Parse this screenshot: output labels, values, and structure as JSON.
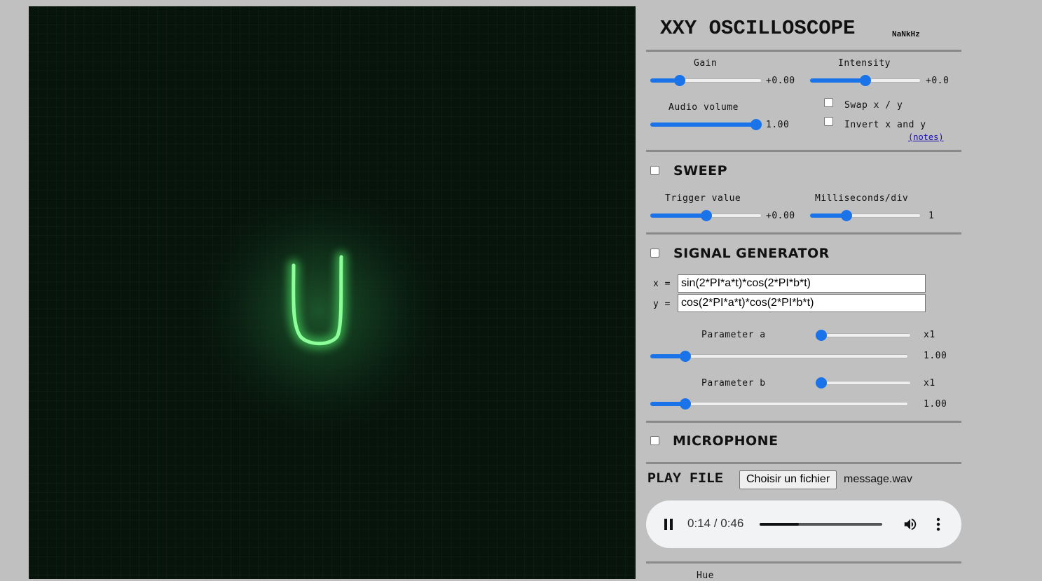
{
  "header": {
    "title": "XXY OSCILLOSCOPE",
    "frequency": "NaNkHz"
  },
  "controls": {
    "gain": {
      "label": "Gain",
      "value": "+0.00",
      "level": 0.24
    },
    "intensity": {
      "label": "Intensity",
      "value": "+0.0",
      "level": 0.5
    },
    "audio_volume": {
      "label": "Audio volume",
      "value": "1.00",
      "level": 1.0
    },
    "swap_xy": {
      "label": "Swap x / y",
      "checked": false
    },
    "invert_xy": {
      "label": "Invert x and y",
      "checked": false
    },
    "notes_link": "(notes)"
  },
  "sweep": {
    "title": "SWEEP",
    "checked": false,
    "trigger": {
      "label": "Trigger value",
      "value": "+0.00",
      "level": 0.5
    },
    "ms_per_div": {
      "label": "Milliseconds/div",
      "value": "1",
      "level": 0.31
    }
  },
  "signal_generator": {
    "title": "SIGNAL GENERATOR",
    "checked": false,
    "x_label": "x =",
    "y_label": "y =",
    "x_expr": "sin(2*PI*a*t)*cos(2*PI*b*t)",
    "y_expr": "cos(2*PI*a*t)*cos(2*PI*b*t)",
    "param_a": {
      "label": "Parameter a",
      "multiplier": "x1",
      "value": "1.00",
      "coarse_level": 0.0,
      "fine_level": 0.12
    },
    "param_b": {
      "label": "Parameter b",
      "multiplier": "x1",
      "value": "1.00",
      "coarse_level": 0.0,
      "fine_level": 0.12
    }
  },
  "microphone": {
    "title": "MICROPHONE",
    "checked": false
  },
  "play_file": {
    "title": "PLAY FILE",
    "button_label": "Choisir un fichier",
    "file_name": "message.wav",
    "player": {
      "time": "0:14 / 0:46",
      "progress": 0.32
    }
  },
  "hue": {
    "label": "Hue"
  },
  "icons": {
    "pause": "pause-icon",
    "volume": "volume-icon",
    "more": "more-options-icon"
  },
  "colors": {
    "accent": "#1a73e8",
    "trace": "#7dff8a",
    "screen": "#07140c"
  }
}
